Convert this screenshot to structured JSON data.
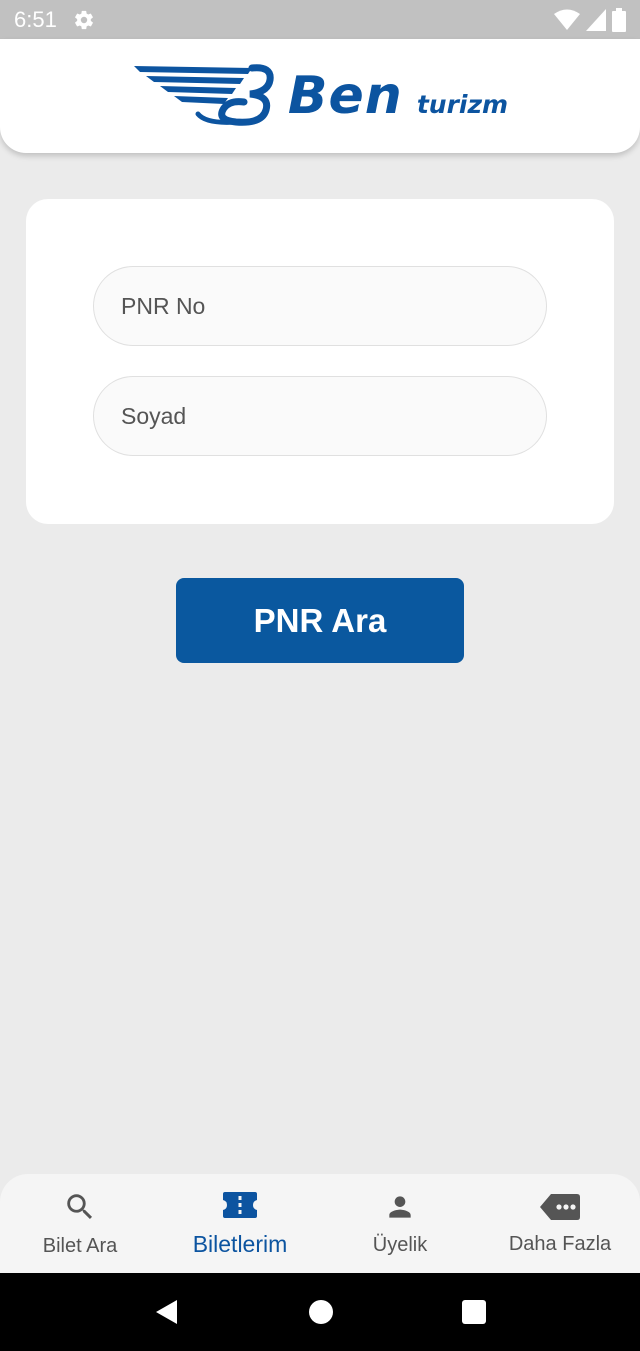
{
  "status_bar": {
    "time": "6:51"
  },
  "header": {
    "logo_main": "Ben",
    "logo_sub": "turizm",
    "brand_color": "#0c54a0"
  },
  "form": {
    "pnr_placeholder": "PNR No",
    "pnr_value": "",
    "surname_placeholder": "Soyad",
    "surname_value": ""
  },
  "search_button": {
    "label": "PNR Ara",
    "color": "#0a589f"
  },
  "bottom_nav": {
    "items": [
      {
        "label": "Bilet Ara",
        "icon": "search-icon",
        "active": false
      },
      {
        "label": "Biletlerim",
        "icon": "ticket-icon",
        "active": true
      },
      {
        "label": "Üyelik",
        "icon": "person-icon",
        "active": false
      },
      {
        "label": "Daha Fazla",
        "icon": "more-icon",
        "active": false
      }
    ]
  }
}
